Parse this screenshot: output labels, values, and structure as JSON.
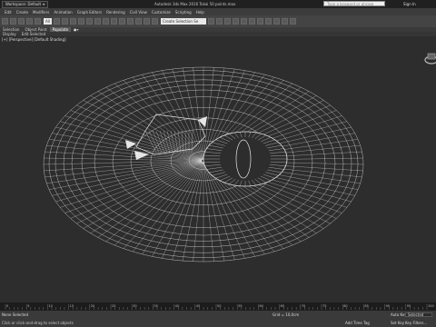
{
  "titlebar": {
    "workspace_label": "Workspace: Default",
    "title": "Autodesk 3ds Max 2016    Tokai 50 points.max",
    "search_placeholder": "Type a keyword or phrase",
    "signin_label": "Sign In"
  },
  "menubar": {
    "items": [
      "Edit",
      "Create",
      "Modifiers",
      "Animation",
      "Graph Editors",
      "Rendering",
      "Civil View",
      "Customize",
      "Scripting",
      "Help"
    ]
  },
  "toolbar": {
    "selection_filter": "All",
    "named_selection": "Create Selection Se"
  },
  "ribbon": {
    "tabs": [
      "Selection",
      "Object Paint",
      "Populate"
    ],
    "active_tab": "Populate",
    "subtabs": [
      "Display",
      "Edit Selected"
    ]
  },
  "viewport": {
    "label": "[+] [Perspective] [Default Shading]",
    "wire_color": "#e6e6e6"
  },
  "timeline": {
    "frame_ticks": [
      "0",
      "5",
      "10",
      "15",
      "20",
      "25",
      "30",
      "35",
      "40",
      "45",
      "50",
      "55",
      "60",
      "65",
      "70",
      "75",
      "80",
      "85",
      "90",
      "95",
      "100"
    ]
  },
  "statusbar": {
    "selection_status": "None Selected",
    "hint": "Click or click-and-drag to select objects",
    "grid": "Grid = 10,0cm",
    "add_time_tag": "Add Time Tag",
    "auto_key": "Auto Key",
    "set_key": "Set Key",
    "key_filter": "Selected",
    "key_filters_label": "Key Filters..."
  }
}
